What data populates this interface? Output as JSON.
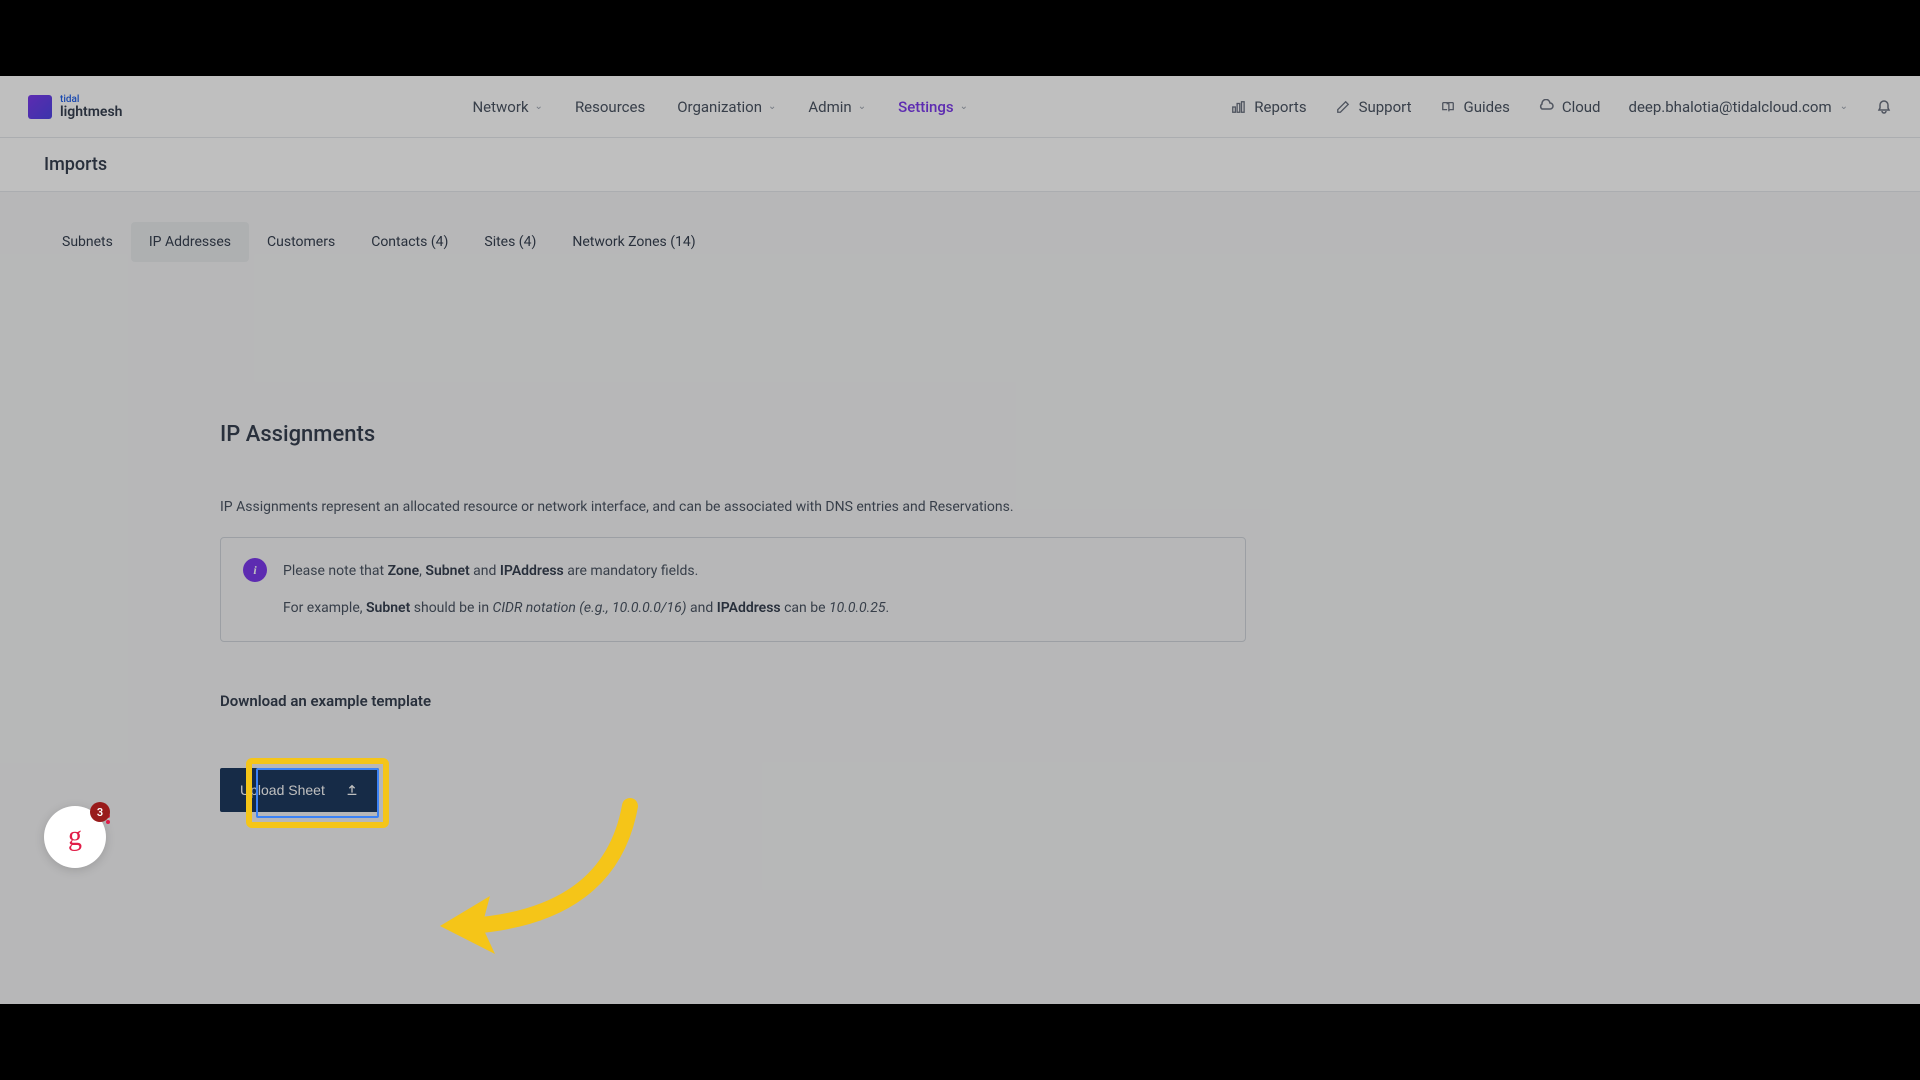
{
  "logo": {
    "top": "tidal",
    "bottom": "lightmesh"
  },
  "nav": {
    "network": "Network",
    "resources": "Resources",
    "organization": "Organization",
    "admin": "Admin",
    "settings": "Settings"
  },
  "nav_right": {
    "reports": "Reports",
    "support": "Support",
    "guides": "Guides",
    "cloud": "Cloud",
    "user": "deep.bhalotia@tidalcloud.com"
  },
  "page_title": "Imports",
  "tabs": {
    "subnets": "Subnets",
    "ip_addresses": "IP Addresses",
    "customers": "Customers",
    "contacts": "Contacts (4)",
    "sites": "Sites (4)",
    "network_zones": "Network Zones (14)"
  },
  "content": {
    "heading": "IP Assignments",
    "description": "IP Assignments represent an allocated resource or network interface, and can be associated with DNS entries and Reservations.",
    "info_prefix": "Please note that ",
    "info_zone": "Zone",
    "info_comma": ", ",
    "info_subnet": "Subnet",
    "info_and": " and ",
    "info_ipaddress": "IPAddress",
    "info_suffix": " are mandatory fields.",
    "info_line2_prefix": "For example, ",
    "info_line2_subnet": "Subnet",
    "info_line2_should": " should be in ",
    "info_line2_cidr": "CIDR notation (e.g., 10.0.0.0/16)",
    "info_line2_and": " and ",
    "info_line2_ip": "IPAddress",
    "info_line2_canbe": " can be ",
    "info_line2_example": "10.0.0.25",
    "info_line2_period": ".",
    "download_link": "Download an example template",
    "upload_button": "Upload Sheet"
  },
  "badge": {
    "count": "3",
    "letter": "g"
  }
}
